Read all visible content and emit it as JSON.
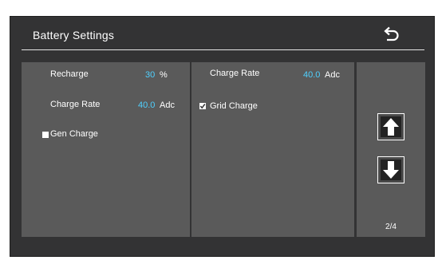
{
  "header": {
    "title": "Battery Settings",
    "back_icon": "back-return-icon"
  },
  "left_panel": {
    "recharge": {
      "label": "Recharge",
      "value": "30",
      "unit": "%"
    },
    "charge_rate": {
      "label": "Charge Rate",
      "value": "40.0",
      "unit": "Adc"
    },
    "gen_charge": {
      "label": "Gen Charge",
      "checked": false
    }
  },
  "mid_panel": {
    "charge_rate": {
      "label": "Charge Rate",
      "value": "40.0",
      "unit": "Adc"
    },
    "grid_charge": {
      "label": "Grid Charge",
      "checked": true
    }
  },
  "nav": {
    "up_icon": "arrow-up-icon",
    "down_icon": "arrow-down-icon",
    "page": "2/4"
  },
  "colors": {
    "background": "#333334",
    "panel": "#5a5a5a",
    "value_accent": "#4fd0ff",
    "text": "#ffffff"
  }
}
